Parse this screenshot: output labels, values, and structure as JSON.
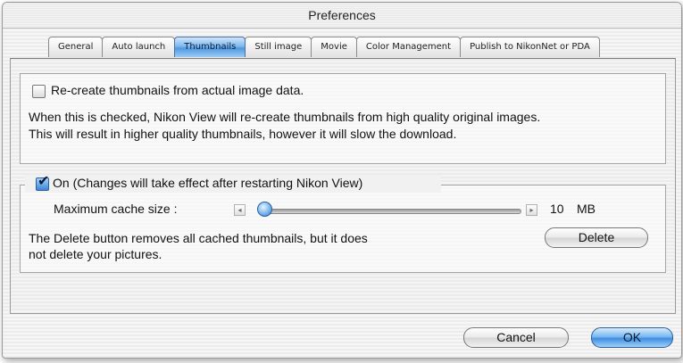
{
  "window": {
    "title": "Preferences"
  },
  "tabs": [
    {
      "label": "General"
    },
    {
      "label": "Auto launch"
    },
    {
      "label": "Thumbnails",
      "active": true
    },
    {
      "label": "Still image"
    },
    {
      "label": "Movie"
    },
    {
      "label": "Color Management"
    },
    {
      "label": "Publish to NikonNet or PDA"
    }
  ],
  "recreate": {
    "checkbox_label": "Re-create thumbnails from actual image data.",
    "checked": false,
    "description_line1": "When this is checked, Nikon View will re-create thumbnails from high quality original images.",
    "description_line2": "This will result in higher quality thumbnails, however it will slow the download."
  },
  "cache": {
    "checkbox_label": "On (Changes will take effect after restarting Nikon View)",
    "checked": true,
    "size_label": "Maximum cache size :",
    "value": "10",
    "unit": "MB",
    "slider_fraction": 0.0,
    "delete_note_line1": "The Delete button removes all cached thumbnails, but it does",
    "delete_note_line2": "not delete your pictures.",
    "delete_button": "Delete"
  },
  "buttons": {
    "cancel": "Cancel",
    "ok": "OK"
  },
  "colors": {
    "accent": "#3e8ee0",
    "checkbox_checked": "#3b86d6"
  },
  "icons": {
    "checkmark": "checkmark-icon",
    "left_arrow": "arrow-left-icon",
    "right_arrow": "arrow-right-icon"
  }
}
